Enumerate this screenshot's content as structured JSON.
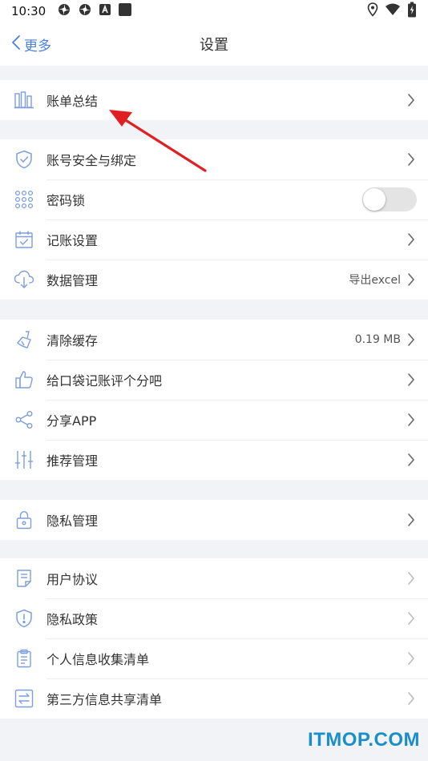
{
  "status_bar": {
    "time": "10:30"
  },
  "nav": {
    "back_label": "更多",
    "title": "设置"
  },
  "groups": [
    {
      "items": [
        {
          "label": "账单总结",
          "icon": "chart-bars-icon"
        }
      ]
    },
    {
      "items": [
        {
          "label": "账号安全与绑定",
          "icon": "shield-check-icon"
        },
        {
          "label": "密码锁",
          "icon": "keypad-icon",
          "toggle": false
        },
        {
          "label": "记账设置",
          "icon": "calendar-check-icon"
        },
        {
          "label": "数据管理",
          "icon": "cloud-download-icon",
          "value": "导出excel"
        }
      ]
    },
    {
      "items": [
        {
          "label": "清除缓存",
          "icon": "broom-icon",
          "value": "0.19 MB"
        },
        {
          "label": "给口袋记账评个分吧",
          "icon": "thumbs-up-icon"
        },
        {
          "label": "分享APP",
          "icon": "share-icon"
        },
        {
          "label": "推荐管理",
          "icon": "sliders-icon"
        }
      ]
    },
    {
      "items": [
        {
          "label": "隐私管理",
          "icon": "lock-icon"
        }
      ]
    },
    {
      "items": [
        {
          "label": "用户协议",
          "icon": "document-icon"
        },
        {
          "label": "隐私政策",
          "icon": "shield-info-icon"
        },
        {
          "label": "个人信息收集清单",
          "icon": "clipboard-icon"
        },
        {
          "label": "第三方信息共享清单",
          "icon": "exchange-icon"
        }
      ]
    }
  ],
  "watermark": "ITMOP.COM",
  "colors": {
    "accent": "#4a7fe0",
    "annotation_arrow": "#e02020",
    "watermark": "#1a8ec9"
  }
}
